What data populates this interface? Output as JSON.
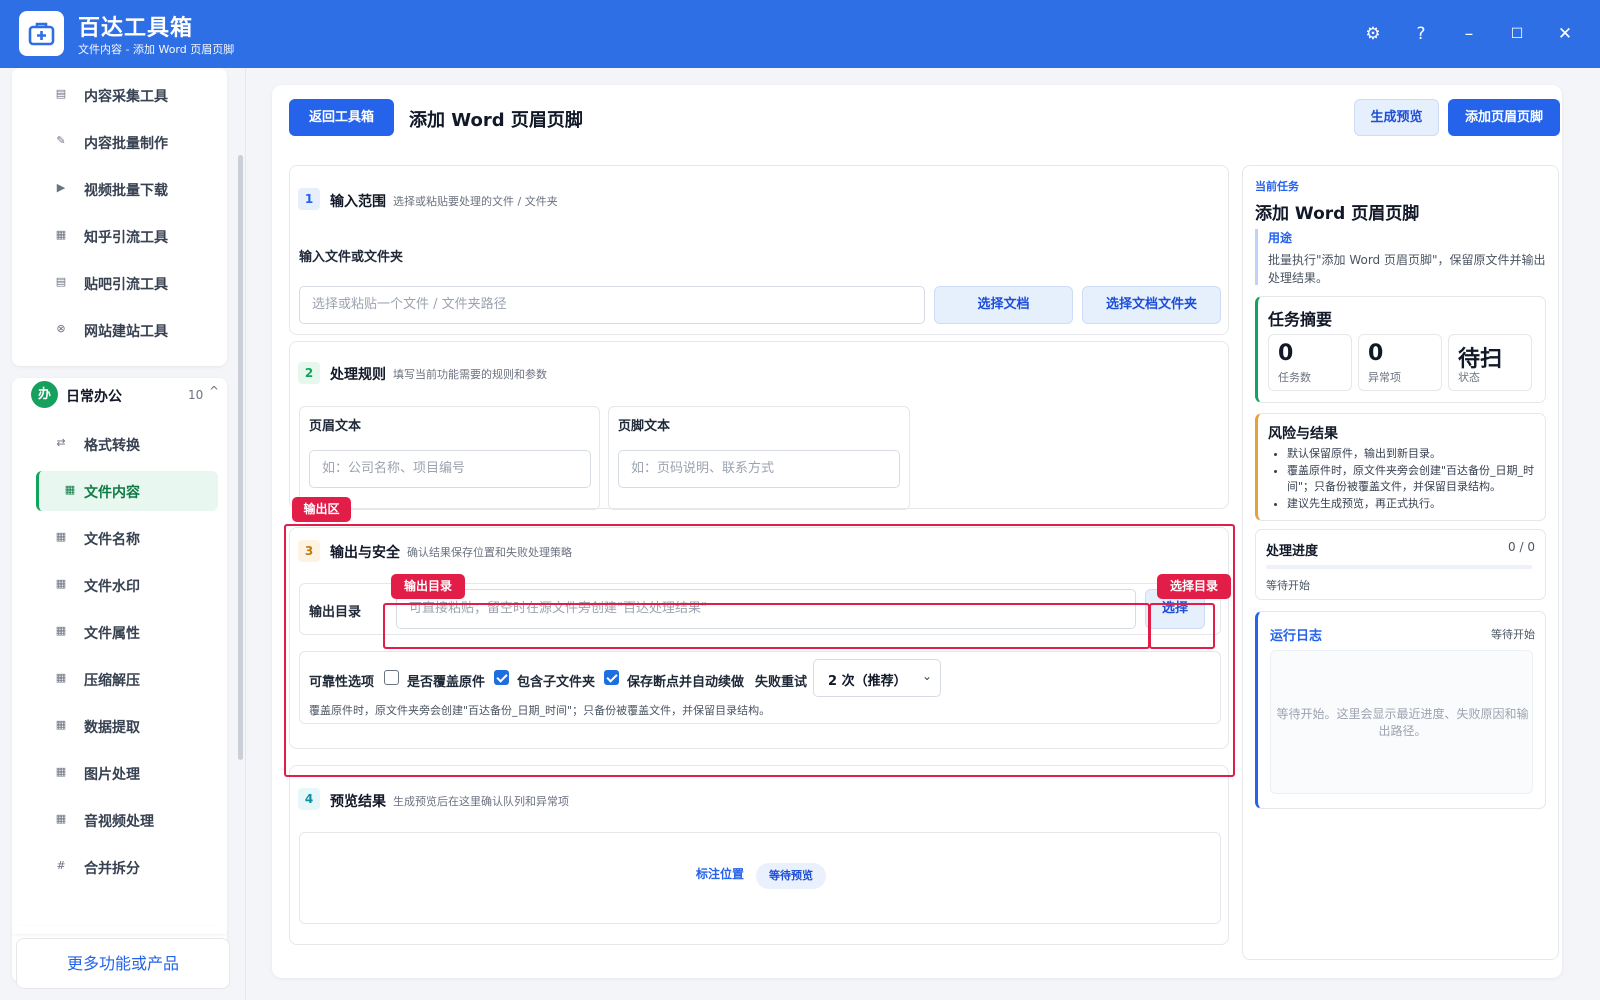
{
  "app": {
    "title": "百达工具箱",
    "subtitle": "文件内容 - 添加 Word 页眉页脚"
  },
  "window_controls": {
    "settings": "⚙",
    "help": "?",
    "minimize": "–",
    "maximize": "☐",
    "close": "✕"
  },
  "sidebar": {
    "top_items": [
      {
        "label": "内容采集工具",
        "icon": "▤"
      },
      {
        "label": "内容批量制作",
        "icon": "✎"
      },
      {
        "label": "视频批量下载",
        "icon": "▶"
      },
      {
        "label": "知乎引流工具",
        "icon": "▦"
      },
      {
        "label": "贴吧引流工具",
        "icon": "▤"
      },
      {
        "label": "网站建站工具",
        "icon": "⊗"
      }
    ],
    "group": {
      "badge": "办",
      "title": "日常办公",
      "count": "10",
      "toggle": "^"
    },
    "group_items": [
      {
        "label": "格式转换",
        "icon": "⇄"
      },
      {
        "label": "文件内容",
        "icon": "▦",
        "active": true
      },
      {
        "label": "文件名称",
        "icon": "▦"
      },
      {
        "label": "文件水印",
        "icon": "▦"
      },
      {
        "label": "文件属性",
        "icon": "▦"
      },
      {
        "label": "压缩解压",
        "icon": "▦"
      },
      {
        "label": "数据提取",
        "icon": "▦"
      },
      {
        "label": "图片处理",
        "icon": "▦"
      },
      {
        "label": "音视频处理",
        "icon": "▦"
      },
      {
        "label": "合并拆分",
        "icon": "#"
      }
    ],
    "more_button": "更多功能或产品"
  },
  "header": {
    "back_button": "返回工具箱",
    "title": "添加 Word 页眉页脚",
    "preview_button": "生成预览",
    "run_button": "添加页眉页脚"
  },
  "section1": {
    "num": "1",
    "title": "输入范围",
    "hint": "选择或粘贴要处理的文件 / 文件夹",
    "field_label": "输入文件或文件夹",
    "input_placeholder": "选择或粘贴一个文件 / 文件夹路径",
    "choose_doc_button": "选择文档",
    "choose_folder_button": "选择文档文件夹"
  },
  "section2": {
    "num": "2",
    "title": "处理规则",
    "hint": "填写当前功能需要的规则和参数",
    "header_label": "页眉文本",
    "header_placeholder": "如：公司名称、项目编号",
    "footer_label": "页脚文本",
    "footer_placeholder": "如：页码说明、联系方式"
  },
  "section3": {
    "num": "3",
    "title": "输出与安全",
    "hint": "确认结果保存位置和失败处理策略",
    "output_label": "输出目录",
    "output_placeholder": "可直接粘贴；留空时在源文件旁创建\"百达处理结果\"",
    "choose_button": "选择",
    "reliability_label": "可靠性选项",
    "overwrite_label": "是否覆盖原件",
    "overwrite_checked": false,
    "subfolder_label": "包含子文件夹",
    "subfolder_checked": true,
    "resume_label": "保存断点并自动续做",
    "resume_checked": true,
    "retry_label": "失败重试",
    "retry_value": "2 次（推荐）",
    "note": "覆盖原件时，原文件夹旁会创建\"百达备份_日期_时间\"；只备份被覆盖文件，并保留目录结构。"
  },
  "section4": {
    "num": "4",
    "title": "预览结果",
    "hint": "生成预览后在这里确认队列和异常项",
    "anchor_link": "标注位置",
    "status_chip": "等待预览"
  },
  "annotations": {
    "output_area": "输出区",
    "output_dir": "输出目录",
    "choose_dir": "选择目录"
  },
  "right_panel": {
    "current_task_label": "当前任务",
    "task_title": "添加 Word 页眉页脚",
    "usage_label": "用途",
    "usage_text": "批量执行\"添加 Word 页眉页脚\"，保留原文件并输出处理结果。",
    "summary": {
      "title": "任务摘要",
      "stats": [
        {
          "value": "0",
          "label": "任务数"
        },
        {
          "value": "0",
          "label": "异常项"
        },
        {
          "value": "待扫",
          "label": "状态"
        }
      ]
    },
    "risk": {
      "title": "风险与结果",
      "items": [
        "默认保留原件，输出到新目录。",
        "覆盖原件时，原文件夹旁会创建\"百达备份_日期_时间\"；只备份被覆盖文件，并保留目录结构。",
        "建议先生成预览，再正式执行。"
      ]
    },
    "progress": {
      "title": "处理进度",
      "count": "0 / 0",
      "status": "等待开始",
      "fraction": 0
    },
    "log": {
      "title": "运行日志",
      "status": "等待开始",
      "placeholder": "等待开始。这里会显示最近进度、失败原因和输出路径。"
    }
  },
  "colors": {
    "brand": "#2f6fe6",
    "accent_green": "#10a45c",
    "annotation_red": "#e11d48"
  }
}
